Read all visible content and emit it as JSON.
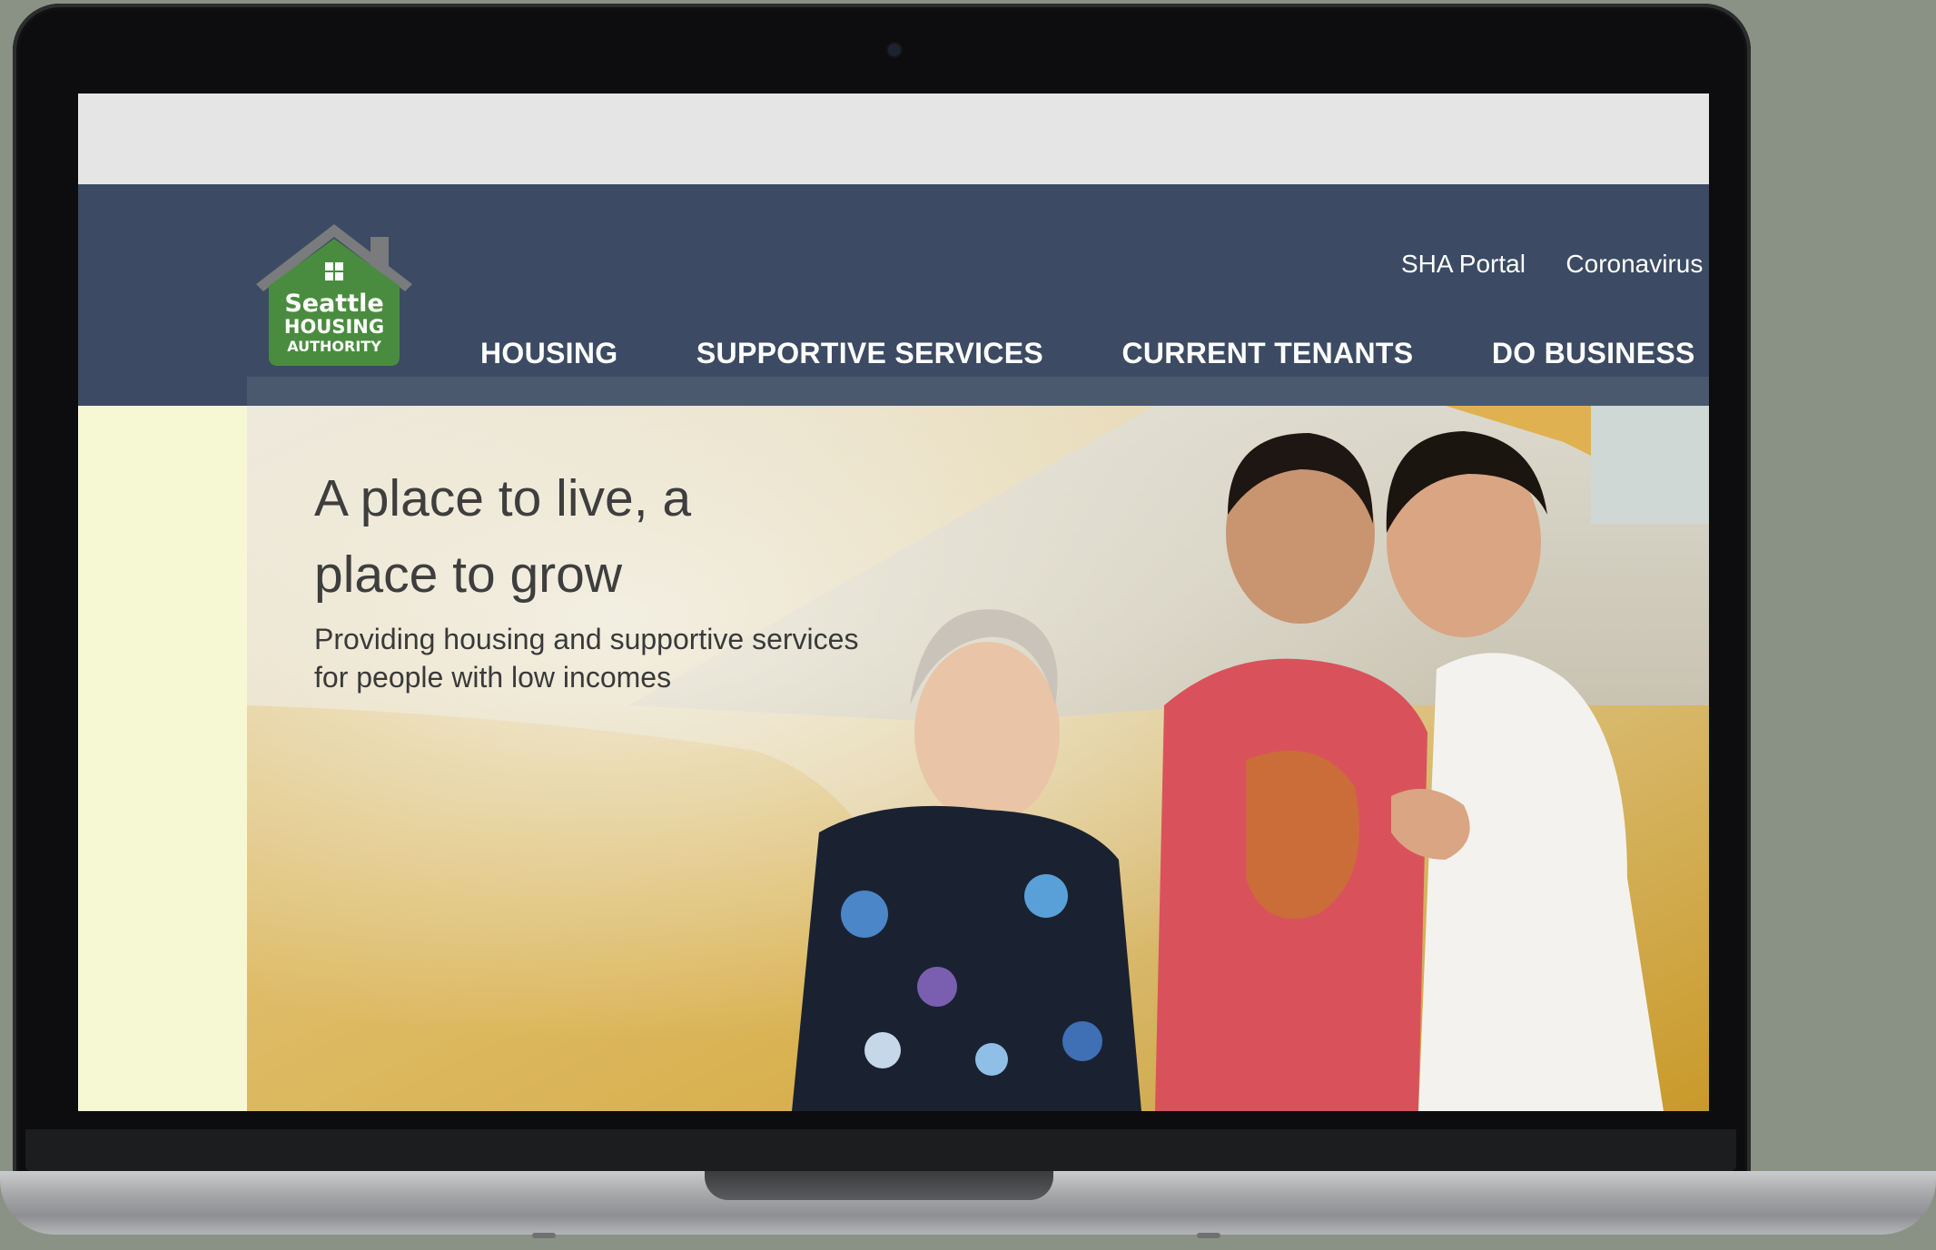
{
  "window": {
    "title": "Seattle Housing Authority"
  },
  "logo": {
    "line1": "Seattle",
    "line2": "HOUSING",
    "line3": "AUTHORITY",
    "color": "#4a8c3f"
  },
  "utility_links": [
    {
      "label": "SHA Portal"
    },
    {
      "label": "Coronavirus"
    }
  ],
  "main_nav": [
    {
      "label": "HOUSING"
    },
    {
      "label": "SUPPORTIVE SERVICES"
    },
    {
      "label": "CURRENT TENANTS"
    },
    {
      "label": "DO BUSINESS"
    }
  ],
  "hero": {
    "title": "A place to live, a place to grow",
    "subtitle": "Providing housing and supportive services for people with low incomes"
  },
  "colors": {
    "header_bg": "#3c4b63",
    "sidebar_bg": "#f6f8d3",
    "topbar_bg": "#e5e5e6"
  }
}
